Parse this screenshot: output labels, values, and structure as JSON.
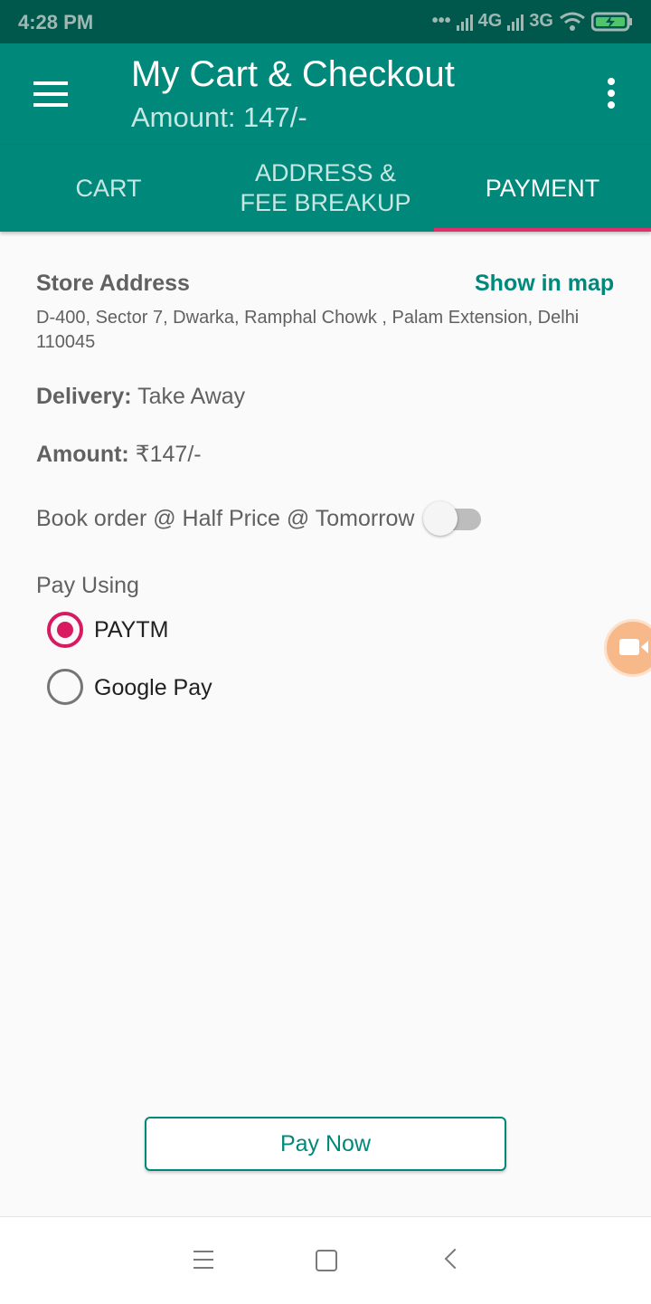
{
  "status_bar": {
    "time": "4:28 PM",
    "network_1": "4G",
    "network_2": "3G"
  },
  "app_bar": {
    "title": "My Cart & Checkout",
    "subtitle": "Amount: 147/-"
  },
  "tabs": [
    {
      "label": "CART",
      "active": false
    },
    {
      "label": "ADDRESS & FEE BREAKUP",
      "active": false
    },
    {
      "label": "PAYMENT",
      "active": true
    }
  ],
  "store": {
    "label": "Store Address",
    "map_link": "Show in map",
    "address": "D-400, Sector 7, Dwarka, Ramphal Chowk , Palam Extension, Delhi 110045"
  },
  "delivery": {
    "label": "Delivery:",
    "value": "Take Away"
  },
  "amount": {
    "label": "Amount:",
    "value": "₹147/-"
  },
  "half_price": {
    "label": "Book order @ Half Price @ Tomorrow",
    "enabled": false
  },
  "pay_using": {
    "label": "Pay Using",
    "options": [
      {
        "label": "PAYTM",
        "selected": true
      },
      {
        "label": "Google Pay",
        "selected": false
      }
    ]
  },
  "pay_button": "Pay Now",
  "colors": {
    "primary": "#00897b",
    "primary_dark": "#00574b",
    "accent": "#d81b60"
  }
}
